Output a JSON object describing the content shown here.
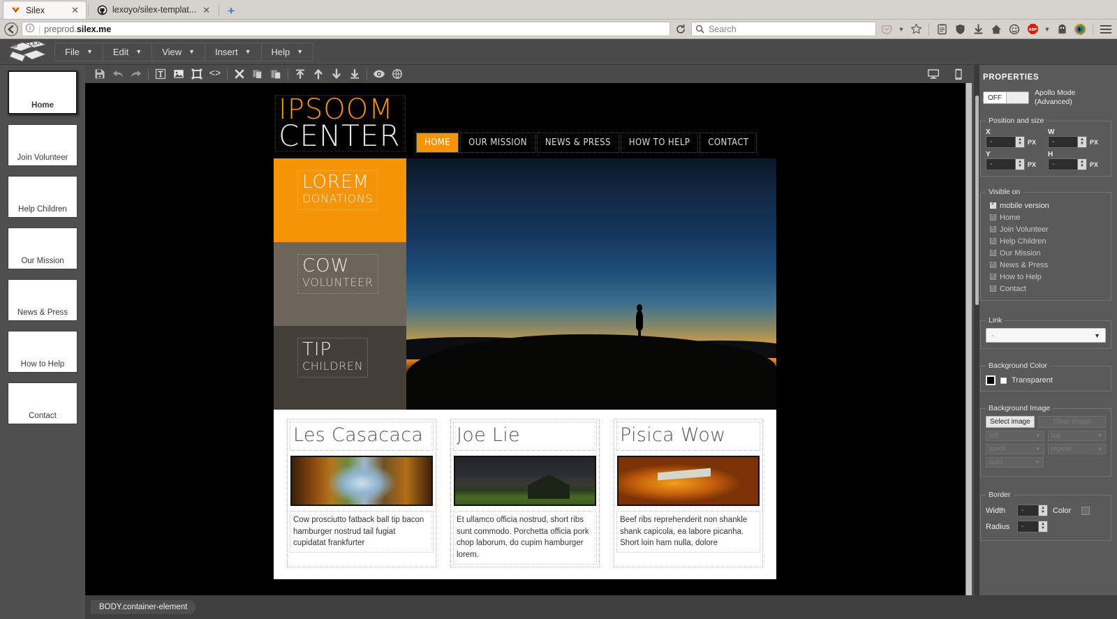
{
  "browser": {
    "tabs": [
      {
        "title": "Silex",
        "favicon": "silex-icon",
        "active": true,
        "close": "✕"
      },
      {
        "title": "lexoyo/silex-templat...",
        "favicon": "github-icon",
        "active": false,
        "close": "✕"
      }
    ],
    "new_tab": "+",
    "url_prefix": "preprod.",
    "url_domain": "silex.me",
    "search_placeholder": "Search",
    "reload_label": "⟳",
    "back_label": "←",
    "icons": [
      "pocket-icon",
      "bookmark-star-icon",
      "reader-icon",
      "shield-icon",
      "download-icon",
      "home-icon",
      "sync-icon",
      "adblock-icon",
      "ghostery-icon",
      "privacy-badger-icon",
      "menu-icon"
    ]
  },
  "app": {
    "logo": "silex-logo",
    "menu": [
      {
        "label": "File"
      },
      {
        "label": "Edit"
      },
      {
        "label": "View"
      },
      {
        "label": "Insert"
      },
      {
        "label": "Help"
      }
    ],
    "toolbar_left": [
      {
        "name": "save-icon",
        "title": "Save"
      },
      {
        "name": "undo-icon",
        "title": "Undo"
      },
      {
        "name": "redo-icon",
        "title": "Redo"
      },
      {
        "name": "insert-text-icon",
        "title": "Text"
      },
      {
        "name": "insert-image-icon",
        "title": "Image"
      },
      {
        "name": "insert-container-icon",
        "title": "Container"
      },
      {
        "name": "insert-html-icon",
        "title": "HTML"
      },
      {
        "name": "delete-icon",
        "title": "Delete"
      },
      {
        "name": "copy-icon",
        "title": "Copy"
      },
      {
        "name": "paste-icon",
        "title": "Paste"
      },
      {
        "name": "move-to-top-icon",
        "title": "Move to top"
      },
      {
        "name": "move-up-icon",
        "title": "Move up"
      },
      {
        "name": "move-down-icon",
        "title": "Move down"
      },
      {
        "name": "move-to-bottom-icon",
        "title": "Move to bottom"
      },
      {
        "name": "preview-icon",
        "title": "Preview"
      },
      {
        "name": "publish-icon",
        "title": "Publish"
      }
    ],
    "toolbar_right": [
      {
        "name": "desktop-view-icon"
      },
      {
        "name": "mobile-view-icon"
      },
      {
        "name": "help-icon"
      }
    ],
    "pages": [
      {
        "label": "Home",
        "selected": true
      },
      {
        "label": "Join Volunteer",
        "selected": false
      },
      {
        "label": "Help Children",
        "selected": false
      },
      {
        "label": "Our Mission",
        "selected": false
      },
      {
        "label": "News & Press",
        "selected": false
      },
      {
        "label": "How to Help",
        "selected": false
      },
      {
        "label": "Contact",
        "selected": false
      }
    ],
    "statusbar": {
      "selection": "BODY.container-element"
    }
  },
  "properties": {
    "title": "PROPERTIES",
    "apollo": {
      "toggle_state": "OFF",
      "label_line1": "Apollo Mode",
      "label_line2": "(Advanced)"
    },
    "position_and_size": {
      "legend": "Position and size",
      "fields": [
        {
          "label": "X",
          "value": "-",
          "unit": "PX"
        },
        {
          "label": "W",
          "value": "-",
          "unit": "PX"
        },
        {
          "label": "Y",
          "value": "-",
          "unit": "PX"
        },
        {
          "label": "H",
          "value": "-",
          "unit": "PX"
        }
      ]
    },
    "visible_on": {
      "legend": "Visible on",
      "items": [
        {
          "label": "mobile version",
          "checked": true,
          "enabled": true
        },
        {
          "label": "Home",
          "checked": true,
          "enabled": false
        },
        {
          "label": "Join Volunteer",
          "checked": true,
          "enabled": false
        },
        {
          "label": "Help Children",
          "checked": true,
          "enabled": false
        },
        {
          "label": "Our Mission",
          "checked": true,
          "enabled": false
        },
        {
          "label": "News & Press",
          "checked": true,
          "enabled": false
        },
        {
          "label": "How to Help",
          "checked": true,
          "enabled": false
        },
        {
          "label": "Contact",
          "checked": true,
          "enabled": false
        }
      ]
    },
    "link": {
      "legend": "Link",
      "value": "-"
    },
    "background_color": {
      "legend": "Background Color",
      "swatch": "#000000",
      "transparent_label": "Transparent",
      "transparent_checked": false
    },
    "background_image": {
      "legend": "Background Image",
      "select_label": "Select image",
      "clear_label": "Clear image",
      "position_x": "left",
      "position_y": "top",
      "attachment": "scroll",
      "repeat": "repeat",
      "size": "auto"
    },
    "border": {
      "legend": "Border",
      "width_label": "Width",
      "width_value": "-",
      "color_label": "Color",
      "color_swatch": "#6d6d6d",
      "radius_label": "Radius",
      "radius_value": "-"
    }
  },
  "site": {
    "logo_line1": "IPSOOM",
    "logo_line2": "CENTER",
    "logo_color": "#f59407",
    "nav": [
      {
        "label": "HOME",
        "active": true
      },
      {
        "label": "OUR MISSION",
        "active": false
      },
      {
        "label": "NEWS & PRESS",
        "active": false
      },
      {
        "label": "HOW TO HELP",
        "active": false
      },
      {
        "label": "CONTACT",
        "active": false
      }
    ],
    "tiles": [
      {
        "title": "LOREM",
        "subtitle": "DONATIONS",
        "color": "#f59407"
      },
      {
        "title": "COW",
        "subtitle": "VOLUNTEER",
        "color": "#6e655a"
      },
      {
        "title": "TIP",
        "subtitle": "CHILDREN",
        "color": "#443f38"
      }
    ],
    "hero_image_alt": "sunset-silhouette-photo",
    "cards": [
      {
        "title": "Les Casacaca",
        "image": "autumn-road-photo",
        "text": "Cow prosciutto fatback ball tip bacon hamburger nostrud tail fugiat cupidatat frankfurter"
      },
      {
        "title": "Joe Lie",
        "image": "night-barn-photo",
        "text": "Et ullamco officia nostrud, short ribs sunt commodo. Porchetta officia pork chop laborum, do cupim hamburger lorem."
      },
      {
        "title": "Pisica Wow",
        "image": "autumn-bench-photo",
        "text": "Beef ribs reprehenderit non shankle shank capicola, ea labore picanha. Short loin ham nulla, dolore"
      }
    ]
  }
}
